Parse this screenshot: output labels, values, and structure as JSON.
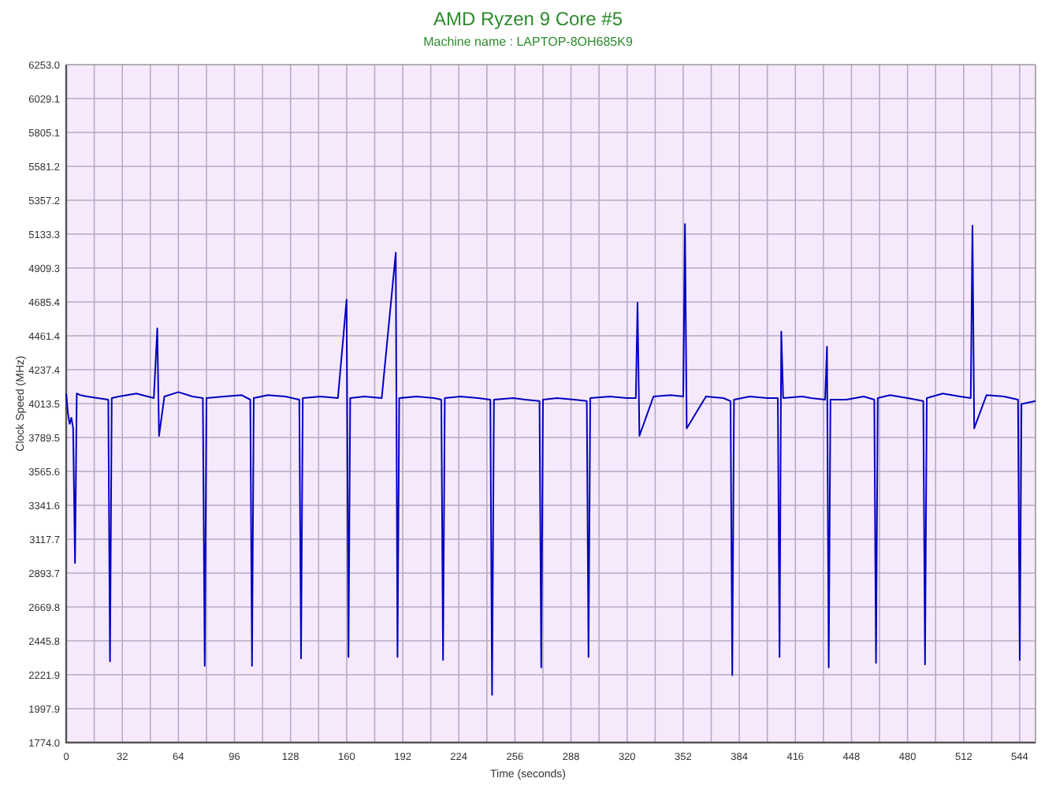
{
  "chart": {
    "subtitle": "Machine name : LAPTOP-8OH685K9",
    "chart_data": {
      "type": "line",
      "title": "AMD Ryzen 9 Core #5",
      "xlabel": "Time (seconds)",
      "ylabel": "Clock Speed (MHz)",
      "grid": true,
      "x": [
        0,
        1,
        2,
        3,
        4,
        5,
        6,
        8,
        12,
        18,
        24,
        25,
        26,
        30,
        40,
        50,
        52,
        53,
        56,
        64,
        72,
        78,
        79,
        80,
        90,
        100,
        105,
        106,
        107,
        115,
        125,
        133,
        134,
        135,
        145,
        155,
        160,
        161,
        162,
        170,
        180,
        188,
        189,
        190,
        200,
        210,
        214,
        215,
        216,
        225,
        235,
        242,
        243,
        244,
        255,
        262,
        270,
        271,
        272,
        280,
        290,
        297,
        298,
        299,
        310,
        320,
        325,
        326,
        327,
        335,
        345,
        352,
        353,
        354,
        365,
        375,
        379,
        380,
        381,
        390,
        400,
        406,
        407,
        408,
        409,
        420,
        425,
        433,
        434,
        435,
        436,
        445,
        455,
        461,
        462,
        463,
        470,
        480,
        489,
        490,
        491,
        500,
        510,
        516,
        517,
        518,
        525,
        535,
        543,
        544,
        545,
        553
      ],
      "series": [
        {
          "color": "#0000c0",
          "values": [
            4080,
            3950,
            3880,
            3920,
            3850,
            2960,
            4080,
            4070,
            4060,
            4050,
            4040,
            2310,
            4050,
            4060,
            4080,
            4050,
            4510,
            3800,
            4060,
            4090,
            4060,
            4050,
            2280,
            4050,
            4060,
            4070,
            4040,
            2280,
            4050,
            4070,
            4060,
            4040,
            2330,
            4050,
            4060,
            4050,
            4700,
            2340,
            4050,
            4060,
            4050,
            5010,
            2340,
            4050,
            4060,
            4050,
            4040,
            2320,
            4050,
            4060,
            4050,
            4040,
            2090,
            4040,
            4050,
            4040,
            4030,
            2270,
            4040,
            4050,
            4040,
            4030,
            2340,
            4050,
            4060,
            4050,
            4050,
            4680,
            3800,
            4060,
            4070,
            4060,
            5200,
            3850,
            4060,
            4050,
            4030,
            2220,
            4040,
            4060,
            4050,
            4050,
            2340,
            4490,
            4050,
            4060,
            4050,
            4040,
            4390,
            2270,
            4040,
            4040,
            4060,
            4040,
            2300,
            4050,
            4070,
            4050,
            4030,
            2290,
            4050,
            4080,
            4060,
            4050,
            5190,
            3850,
            4070,
            4060,
            4040,
            2320,
            4010,
            4030
          ]
        }
      ],
      "xlim": [
        0,
        553
      ],
      "ylim": [
        1774,
        6253
      ],
      "xticks": [
        0,
        32,
        64,
        96,
        128,
        160,
        192,
        224,
        256,
        288,
        320,
        352,
        384,
        416,
        448,
        480,
        512,
        544
      ],
      "yticks": [
        {
          "value": 1774,
          "label": "1774.0"
        },
        {
          "value": 1997.9,
          "label": "1997.9"
        },
        {
          "value": 2221.9,
          "label": "2221.9"
        },
        {
          "value": 2445.8,
          "label": "2445.8"
        },
        {
          "value": 2669.8,
          "label": "2669.8"
        },
        {
          "value": 2893.7,
          "label": "2893.7"
        },
        {
          "value": 3117.7,
          "label": "3117.7"
        },
        {
          "value": 3341.6,
          "label": "3341.6"
        },
        {
          "value": 3565.6,
          "label": "3565.6"
        },
        {
          "value": 3789.5,
          "label": "3789.5"
        },
        {
          "value": 4013.5,
          "label": "4013.5"
        },
        {
          "value": 4237.4,
          "label": "4237.4"
        },
        {
          "value": 4461.4,
          "label": "4461.4"
        },
        {
          "value": 4685.4,
          "label": "4685.4"
        },
        {
          "value": 4909.3,
          "label": "4909.3"
        },
        {
          "value": 5133.3,
          "label": "5133.3"
        },
        {
          "value": 5357.2,
          "label": "5357.2"
        },
        {
          "value": 5581.2,
          "label": "5581.2"
        },
        {
          "value": 5805.1,
          "label": "5805.1"
        },
        {
          "value": 6029.1,
          "label": "6029.1"
        },
        {
          "value": 6253,
          "label": "6253.0"
        }
      ]
    }
  }
}
